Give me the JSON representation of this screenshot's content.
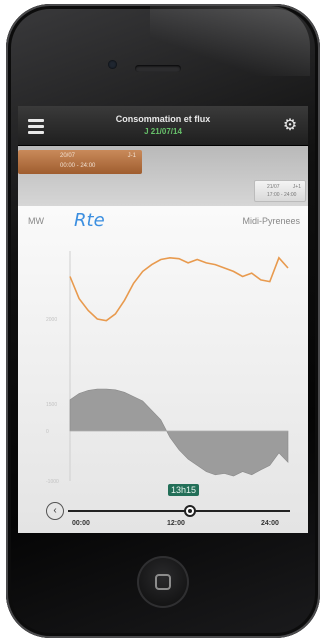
{
  "header": {
    "title": "Consommation et flux",
    "subtitle": "J 21/07/14",
    "menu_icon": "hamburger-menu-icon",
    "settings_icon": "gear-icon"
  },
  "date_selector": {
    "selected": {
      "line1": "20/07",
      "line2": "00:00 - 24:00",
      "side": "J-1"
    },
    "other": {
      "line1": "21/07",
      "line2": "17:00 - 24:00",
      "side": "J+1"
    }
  },
  "chart_meta": {
    "unit": "MW",
    "logo": "Rte",
    "region": "Midi-Pyrenees",
    "current_time": "13h15"
  },
  "chart_data": [
    {
      "type": "line",
      "x": [
        "00:00",
        "01:00",
        "02:00",
        "03:00",
        "04:00",
        "05:00",
        "06:00",
        "07:00",
        "08:00",
        "09:00",
        "10:00",
        "11:00",
        "12:00",
        "13:00",
        "14:00",
        "15:00",
        "16:00",
        "17:00",
        "18:00",
        "19:00",
        "20:00",
        "21:00",
        "22:00",
        "23:00",
        "24:00"
      ],
      "series": [
        {
          "values": [
            2250,
            2120,
            2050,
            2000,
            1990,
            2030,
            2110,
            2210,
            2280,
            2320,
            2350,
            2360,
            2355,
            2330,
            2350,
            2330,
            2320,
            2300,
            2280,
            2250,
            2270,
            2230,
            2220,
            2360,
            2300
          ]
        }
      ],
      "ylim": [
        1400,
        2400
      ],
      "yticks": [
        "2000",
        "1500"
      ],
      "grid": false
    },
    {
      "type": "area",
      "x": [
        "00:00",
        "01:00",
        "02:00",
        "03:00",
        "04:00",
        "05:00",
        "06:00",
        "07:00",
        "08:00",
        "09:00",
        "10:00",
        "11:00",
        "12:00",
        "13:00",
        "14:00",
        "15:00",
        "16:00",
        "17:00",
        "18:00",
        "19:00",
        "20:00",
        "21:00",
        "22:00",
        "23:00",
        "24:00"
      ],
      "series": [
        {
          "values": [
            500,
            600,
            650,
            670,
            670,
            660,
            620,
            550,
            480,
            330,
            180,
            -100,
            -300,
            -450,
            -550,
            -650,
            -700,
            -680,
            -720,
            -650,
            -700,
            -620,
            -550,
            -350,
            -500
          ]
        }
      ],
      "ylim": [
        -800,
        800
      ],
      "yticks": [
        "0",
        "-1000"
      ],
      "grid": false
    }
  ],
  "slider": {
    "xticks": [
      "00:00",
      "12:00",
      "24:00"
    ],
    "value": 0.55,
    "back_icon": "circle-arrow-left-icon"
  }
}
